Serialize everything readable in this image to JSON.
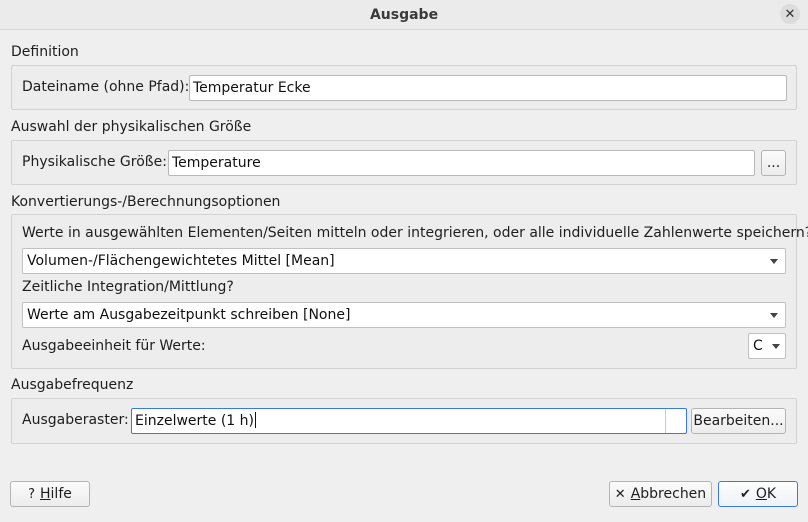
{
  "window": {
    "title": "Ausgabe",
    "close_glyph": "✕"
  },
  "definition": {
    "section_title": "Definition",
    "filename_label": "Dateiname (ohne Pfad):",
    "filename_value": "Temperatur Ecke"
  },
  "quantity": {
    "section_title": "Auswahl der physikalischen Größe",
    "label": "Physikalische Größe:",
    "value": "Temperature",
    "browse_label": "..."
  },
  "options": {
    "section_title": "Konvertierungs-/Berechnungsoptionen",
    "averaging_question": "Werte in ausgewählten Elementen/Seiten mitteln oder integrieren, oder alle individuelle Zahlenwerte speichern?",
    "averaging_selected": "Volumen-/Flächengewichtetes Mittel [Mean]",
    "time_question": "Zeitliche Integration/Mittlung?",
    "time_selected": "Werte am Ausgabezeitpunkt schreiben [None]",
    "unit_label": "Ausgabeeinheit für Werte:",
    "unit_selected": "C"
  },
  "frequency": {
    "section_title": "Ausgabefrequenz",
    "grid_label": "Ausgaberaster:",
    "grid_value": "Einzelwerte (1 h)",
    "edit_label": "Bearbeiten..."
  },
  "footer": {
    "help_first": "H",
    "help_rest": "ilfe",
    "cancel_first": "A",
    "cancel_rest": "bbrechen",
    "ok_first": "O",
    "ok_rest": "K"
  },
  "icons": {
    "help": "question-mark-icon",
    "cancel": "cross-icon",
    "ok": "checkmark-icon"
  },
  "colors": {
    "focus": "#3a7bd5",
    "background": "#efefef"
  }
}
